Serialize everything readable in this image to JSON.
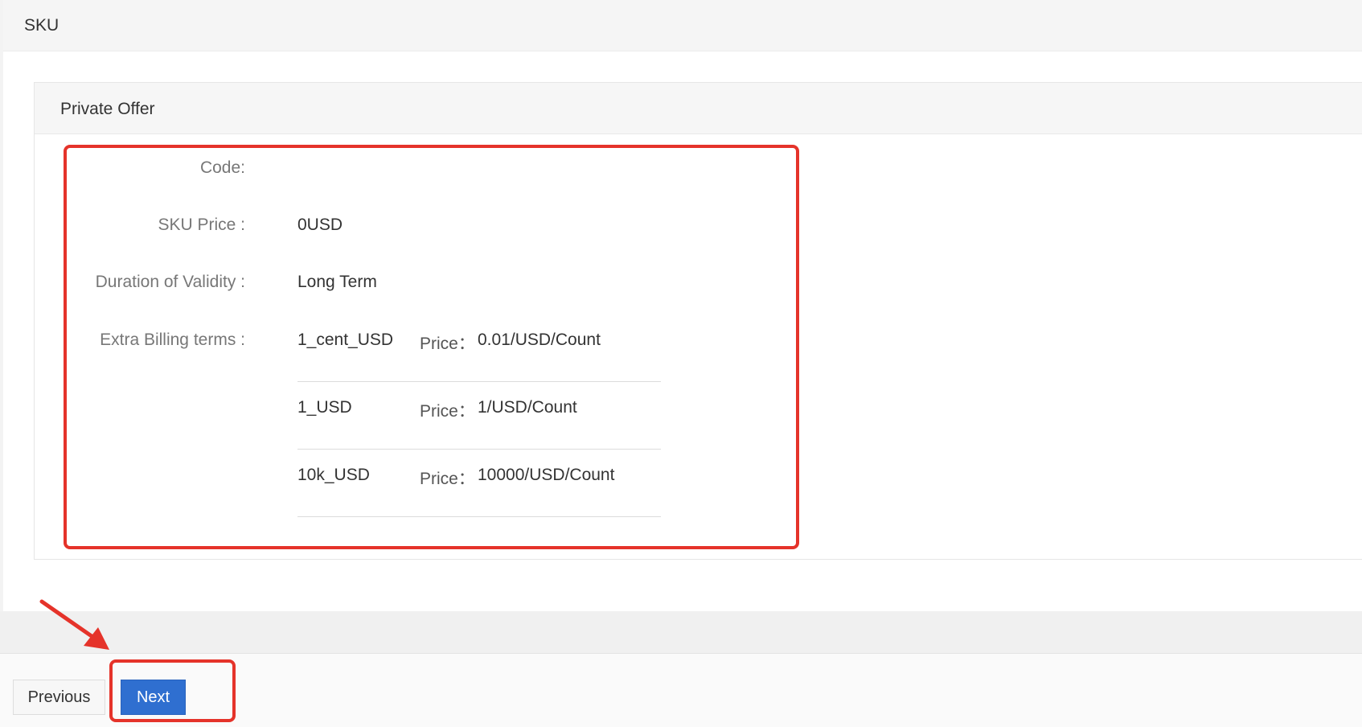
{
  "section": {
    "title": "SKU"
  },
  "panel": {
    "title": "Private Offer"
  },
  "fields": {
    "code_label": "Code:",
    "code_value": "",
    "sku_price_label": "SKU Price :",
    "sku_price_value": "0USD",
    "duration_label": "Duration of Validity :",
    "duration_value": "Long Term",
    "extra_billing_label": "Extra Billing terms :"
  },
  "billing_terms": [
    {
      "name": "1_cent_USD",
      "price_label": "Price：",
      "price_value": "0.01/USD/Count"
    },
    {
      "name": "1_USD",
      "price_label": "Price：",
      "price_value": "1/USD/Count"
    },
    {
      "name": "10k_USD",
      "price_label": "Price：",
      "price_value": "10000/USD/Count"
    }
  ],
  "footer": {
    "previous_label": "Previous",
    "next_label": "Next"
  },
  "colors": {
    "annotation_red": "#e5332a",
    "primary_blue": "#2f6fd0"
  }
}
